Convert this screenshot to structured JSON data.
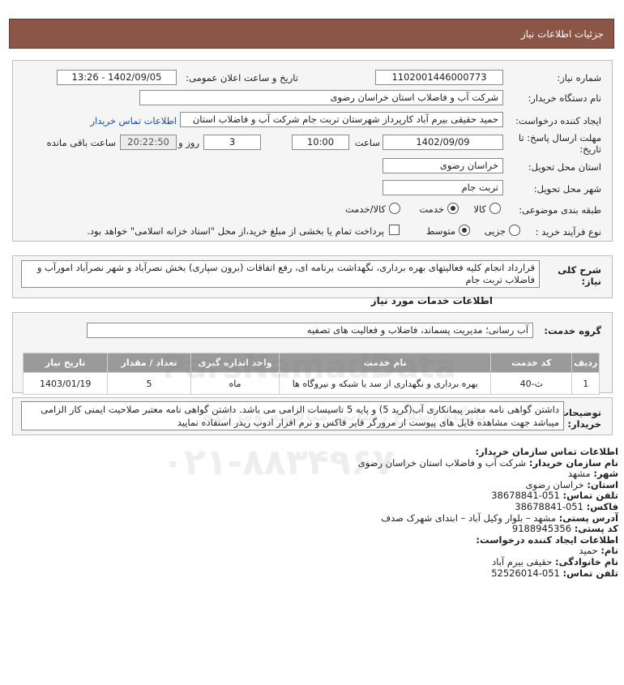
{
  "header": {
    "title": "جزئیات اطلاعات نیاز"
  },
  "form": {
    "need_number_label": "شماره نیاز:",
    "need_number": "1102001446000773",
    "announce_label": "تاریخ و ساعت اعلان عمومی:",
    "announce_value": "1402/09/05 - 13:26",
    "buyer_label": "نام دستگاه خریدار:",
    "buyer_value": "شرکت آب و فاضلاب استان خراسان رضوی",
    "creator_label": "ایجاد کننده درخواست:",
    "creator_value": "حمید حقیقی بیرم آباد کارپرداز شهرستان تربت جام  شرکت آب و فاضلاب استان",
    "contact_link": "اطلاعات تماس خریدار",
    "deadline_label_1": "مهلت ارسال پاسخ: تا",
    "deadline_label_2": "تاریخ:",
    "deadline_date": "1402/09/09",
    "time_label": "ساعت",
    "deadline_time": "10:00",
    "days_value": "3",
    "days_label": "روز و",
    "remaining_value": "20:22:50",
    "remaining_label": "ساعت باقی مانده",
    "province_label": "استان محل تحویل:",
    "province_value": "خراسان رضوی",
    "city_label": "شهر محل تحویل:",
    "city_value": "تربت جام",
    "category_label": "طبقه بندی موضوعی:",
    "category_options": [
      "کالا",
      "خدمت",
      "کالا/خدمت"
    ],
    "category_selected": "خدمت",
    "process_label": "نوع فرآیند خرید :",
    "process_options": [
      "جزیی",
      "متوسط"
    ],
    "process_selected": "متوسط",
    "payment_text": "پرداخت تمام یا بخشی از مبلغ خرید،از محل \"اسناد خزانه اسلامی\" خواهد بود."
  },
  "description": {
    "label_1": "شرح کلی",
    "label_2": "نیاز:",
    "text": "قرارداد انجام کلیه فعالیتهای بهره برداری، نگهداشت برنامه ای، رفع اتفاقات (برون سپاری) بخش نصرآباد و شهر نصرآباد امورآب و فاضلاب تربت جام"
  },
  "services": {
    "title": "اطلاعات خدمات مورد نیاز",
    "group_label": "گروه خدمت:",
    "group_value": "آب رسانی؛ مدیریت پسماند، فاضلاب و فعالیت های تصفیه",
    "columns": [
      "ردیف",
      "کد خدمت",
      "نام خدمت",
      "واحد اندازه گیری",
      "تعداد / مقدار",
      "تاریخ نیاز"
    ],
    "rows": [
      [
        "1",
        "ث-40",
        "بهره برداری و نگهداری از سد یا شبکه و نیروگاه ها",
        "ماه",
        "5",
        "1403/01/19"
      ]
    ]
  },
  "notes": {
    "label_1": "توضیحات",
    "label_2": "خریدار:",
    "text": "داشتن گواهی نامه معتبر پیمانکاری آب(گرید 5) و پایه 5 تاسیسات الزامی می باشد. داشتن گواهی نامه معتبر صلاحیت ایمنی کار الزامی میباشد جهت مشاهده فایل های پیوست از مرورگر فایر فاکس و نرم افزار ادوب ریدر استفاده نمایید"
  },
  "contact": {
    "lines": [
      {
        "label": "اطلاعات تماس سازمان خریدار:",
        "value": ""
      },
      {
        "label": "نام سازمان خریدار:",
        "value": "شرکت آب و فاضلاب استان خراسان رضوی"
      },
      {
        "label": "شهر:",
        "value": "مشهد"
      },
      {
        "label": "استان:",
        "value": "خراسان رضوی"
      },
      {
        "label": "تلفن تماس:",
        "value": "051-38678841"
      },
      {
        "label": "فاکس:",
        "value": "051-38678841"
      },
      {
        "label": "آدرس پستی:",
        "value": "مشهد – بلوار وکیل آباد – ابتدای شهرک صدف"
      },
      {
        "label": "کد پستی:",
        "value": "9188945356"
      },
      {
        "label": "اطلاعات ایجاد کننده درخواست:",
        "value": ""
      },
      {
        "label": "نام:",
        "value": "حمید"
      },
      {
        "label": "نام خانوادگی:",
        "value": "حقیقی بیرم آباد"
      },
      {
        "label": "تلفن تماس:",
        "value": "051-52526014"
      }
    ]
  },
  "watermark": {
    "brand": "ParsNamadData",
    "tagline": "پایگاه اطلاع رسانی مناقصه ومزایده",
    "phone": "۰۲۱-۸۸۳۴۹۶۷۰"
  }
}
